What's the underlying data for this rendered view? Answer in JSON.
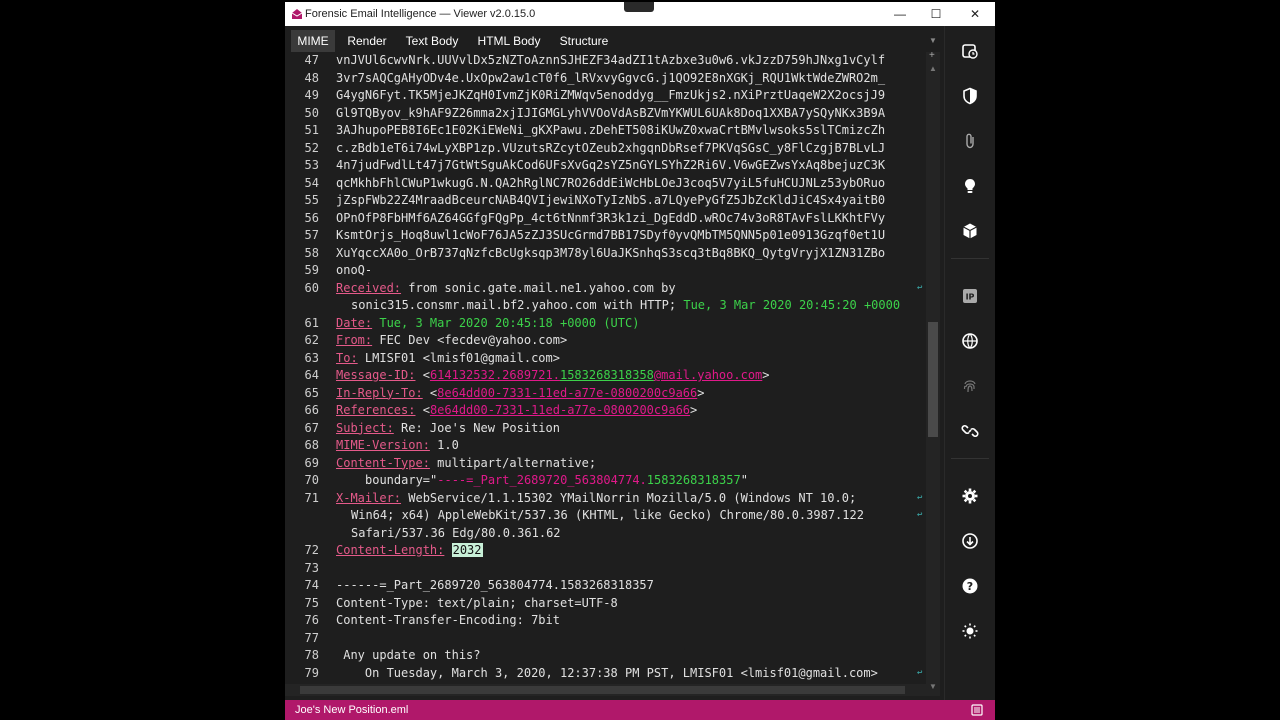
{
  "window": {
    "title": "Forensic Email Intelligence — Viewer v2.0.15.0",
    "minimize": "—",
    "maximize": "☐",
    "close": "✕"
  },
  "tabs": [
    {
      "label": "MIME",
      "active": true
    },
    {
      "label": "Render",
      "active": false
    },
    {
      "label": "Text Body",
      "active": false
    },
    {
      "label": "HTML Body",
      "active": false
    },
    {
      "label": "Structure",
      "active": false
    }
  ],
  "lines": {
    "l47": {
      "n": "47",
      "t": "vnJVUl6cwvNrk.UUVvlDx5zNZToAznnSJHEZF34adZI1tAzbxe3u0w6.vkJzzD759hJNxg1vCylf"
    },
    "l48": {
      "n": "48",
      "t": "3vr7sAQCgAHyODv4e.UxOpw2aw1cT0f6_lRVxvyGgvcG.j1QO92E8nXGKj_RQU1WktWdeZWRO2m_"
    },
    "l49": {
      "n": "49",
      "t": "G4ygN6Fyt.TK5MjeJKZqH0IvmZjK0RiZMWqv5enoddyg__FmzUkjs2.nXiPrztUaqeW2X2ocsjJ9"
    },
    "l50": {
      "n": "50",
      "t": "Gl9TQByov_k9hAF9Z26mma2xjIJIGMGLyhVVOoVdAsBZVmYKWUL6UAk8Doq1XXBA7ySQyNKx3B9A"
    },
    "l51": {
      "n": "51",
      "t": "3AJhupoPEB8I6Ec1E02KiEWeNi_gKXPawu.zDehET508iKUwZ0xwaCrtBMvlwsoks5slTCmizcZh"
    },
    "l52": {
      "n": "52",
      "t": "c.zBdb1eT6i74wLyXBP1zp.VUzutsRZcytOZeub2xhgqnDbRsef7PKVqSGsC_y8FlCzgjB7BLvLJ"
    },
    "l53": {
      "n": "53",
      "t": "4n7judFwdlLt47j7GtWtSguAkCod6UFsXvGq2sYZ5nGYLSYhZ2Ri6V.V6wGEZwsYxAq8bejuzC3K"
    },
    "l54": {
      "n": "54",
      "t": "qcMkhbFhlCWuP1wkugG.N.QA2hRglNC7RO26ddEiWcHbLOeJ3coq5V7yiL5fuHCUJNLz53ybORuo"
    },
    "l55": {
      "n": "55",
      "t": "jZspFWb22Z4MraadBceurcNAB4QVIjewiNXoTyIzNbS.a7LQyePyGfZ5JbZcKldJiC4Sx4yaitB0"
    },
    "l56": {
      "n": "56",
      "t": "OPnOfP8FbHMf6AZ64GGfgFQgPp_4ct6tNnmf3R3k1zi_DgEddD.wROc74v3oR8TAvFslLKKhtFVy"
    },
    "l57": {
      "n": "57",
      "t": "KsmtOrjs_Hoq8uwl1cWoF76JA5zZJ3SUcGrmd7BB17SDyf0yvQMbTM5QNN5p01e0913Gzqf0et1U"
    },
    "l58": {
      "n": "58",
      "t": "XuYqccXA0o_OrB737qNzfcBcUgksqp3M78yl6UaJKSnhqS3scq3tBq8BKQ_QytgVryjX1ZN31ZBo"
    },
    "l59": {
      "n": "59",
      "t": "onoQ-"
    },
    "l60": {
      "n": "60",
      "name": "Received:",
      "value": " from sonic.gate.mail.ne1.yahoo.com by"
    },
    "l60b": {
      "value": "sonic315.consmr.mail.bf2.yahoo.com with HTTP; ",
      "date": "Tue, 3 Mar 2020 20:45:20 +0000"
    },
    "l61": {
      "n": "61",
      "name": "Date:",
      "date": " Tue, 3 Mar 2020 20:45:18 +0000 (UTC)"
    },
    "l62": {
      "n": "62",
      "name": "From:",
      "value": " FEC Dev <fecdev@yahoo.com>"
    },
    "l63": {
      "n": "63",
      "name": "To:",
      "value": " LMISF01 <lmisf01@gmail.com>"
    },
    "l64": {
      "n": "64",
      "name": "Message-ID:",
      "pre": " <",
      "link1": "614132532.2689721.",
      "link2": "1583268318358",
      "link3": "@mail.yahoo.com",
      "post": ">"
    },
    "l65": {
      "n": "65",
      "name": "In-Reply-To:",
      "pre": " <",
      "link": "8e64dd00-7331-11ed-a77e-0800200c9a66",
      "post": ">"
    },
    "l66": {
      "n": "66",
      "name": "References:",
      "pre": " <",
      "link": "8e64dd00-7331-11ed-a77e-0800200c9a66",
      "post": ">"
    },
    "l67": {
      "n": "67",
      "name": "Subject:",
      "value": " Re: Joe's New Position"
    },
    "l68": {
      "n": "68",
      "name": "MIME-Version:",
      "value": " 1.0"
    },
    "l69": {
      "n": "69",
      "name": "Content-Type:",
      "value": " multipart/alternative;"
    },
    "l70": {
      "n": "70",
      "pre": "boundary=\"",
      "b1": "----=_Part_2689720_563804774.",
      "b2": "1583268318357",
      "post": "\""
    },
    "l71": {
      "n": "71",
      "name": "X-Mailer:",
      "value": " WebService/1.1.15302 YMailNorrin Mozilla/5.0 (Windows NT 10.0;"
    },
    "l71b": {
      "value": "Win64; x64) AppleWebKit/537.36 (KHTML, like Gecko) Chrome/80.0.3987.122"
    },
    "l71c": {
      "value": "Safari/537.36 Edg/80.0.361.62"
    },
    "l72": {
      "n": "72",
      "name": "Content-Length:",
      "value": "2032"
    },
    "l73": {
      "n": "73",
      "t": ""
    },
    "l74": {
      "n": "74",
      "t": "------=_Part_2689720_563804774.1583268318357"
    },
    "l75": {
      "n": "75",
      "t": "Content-Type: text/plain; charset=UTF-8"
    },
    "l76": {
      "n": "76",
      "t": "Content-Transfer-Encoding: 7bit"
    },
    "l77": {
      "n": "77",
      "t": ""
    },
    "l78": {
      "n": "78",
      "t": " Any update on this?"
    },
    "l79": {
      "n": "79",
      "t": "    On Tuesday, March 3, 2020, 12:37:38 PM PST, LMISF01 <lmisf01@gmail.com>"
    }
  },
  "status": {
    "filename": "Joe's New Position.eml"
  },
  "colors": {
    "accent": "#b0186a",
    "header_name": "#e55a8a",
    "date": "#3cd24a",
    "link": "#e0198a"
  },
  "sidebar_icons": [
    "history-icon",
    "shield-icon",
    "paperclip-icon",
    "lightbulb-icon",
    "cube-icon",
    "ip-icon",
    "globe-icon",
    "fingerprint-icon",
    "link-icon",
    "gear-icon",
    "download-icon",
    "help-icon",
    "brightness-icon"
  ]
}
